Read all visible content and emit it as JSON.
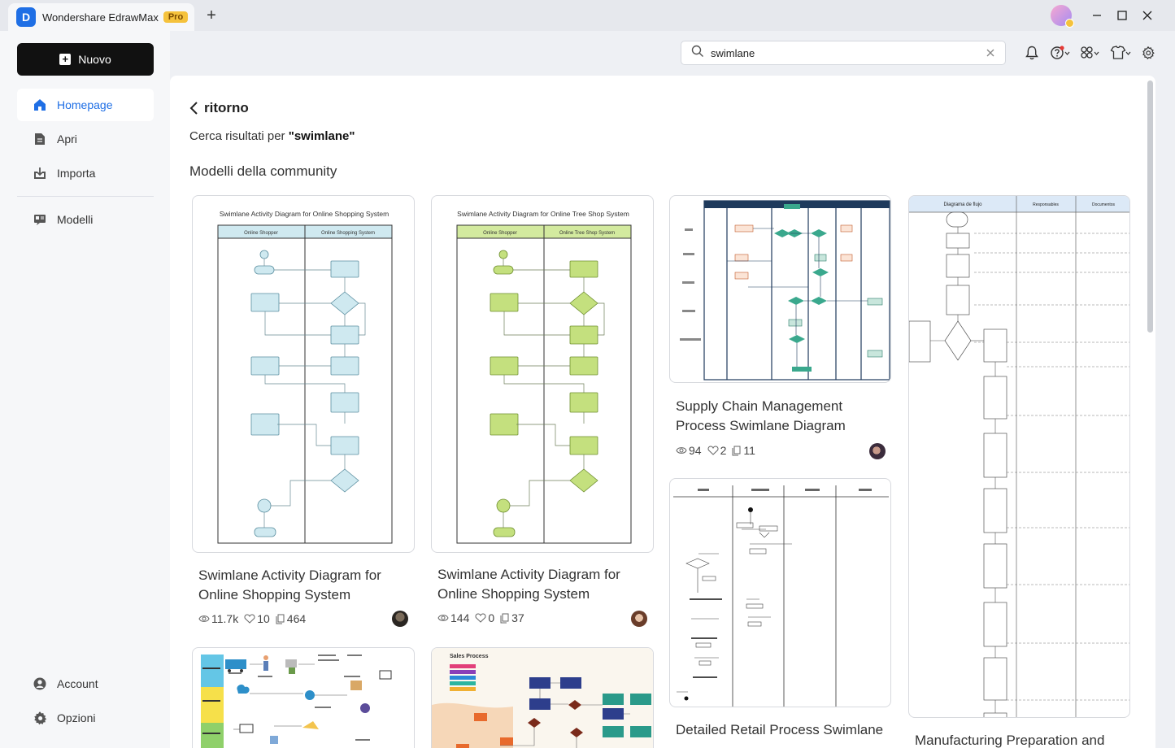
{
  "app": {
    "name": "Wondershare EdrawMax",
    "badge": "Pro",
    "logo_letter": "D"
  },
  "sidebar": {
    "new_label": "Nuovo",
    "items": [
      {
        "label": "Homepage",
        "icon": "home-icon",
        "active": true
      },
      {
        "label": "Apri",
        "icon": "file-icon"
      },
      {
        "label": "Importa",
        "icon": "import-icon"
      },
      {
        "label": "Modelli",
        "icon": "templates-icon"
      }
    ],
    "bottom": [
      {
        "label": "Account",
        "icon": "account-icon"
      },
      {
        "label": "Opzioni",
        "icon": "gear-icon"
      }
    ]
  },
  "search": {
    "value": "swimlane",
    "placeholder": ""
  },
  "main": {
    "back_label": "ritorno",
    "results_prefix": "Cerca risultati per ",
    "results_query": "\"swimlane\"",
    "section_title": "Modelli della community"
  },
  "cards": [
    {
      "title": "Swimlane Activity Diagram for Online Shopping System",
      "views": "11.7k",
      "likes": "10",
      "copies": "464",
      "thumb_title": "Swimlane Activity Diagram for Online Shopping System",
      "lanes": [
        "Online Shopper",
        "Online Shopping System"
      ],
      "accent": "#cfe9f0"
    },
    {
      "title": "Swimlane Activity Diagram for Online Shopping System",
      "views": "144",
      "likes": "0",
      "copies": "37",
      "thumb_title": "Swimlane Activity Diagram for Online Tree Shop System",
      "lanes": [
        "Online Shopper",
        "Online Tree Shop System"
      ],
      "accent": "#d3ea9f"
    },
    {
      "title": "Supply Chain Management Process Swimlane Diagram",
      "views": "94",
      "likes": "2",
      "copies": "11"
    },
    {
      "title": "Manufacturing Preparation and",
      "thumb_title": "Diagrama de flujo",
      "lanes": [
        "Responsables",
        "Documentos"
      ]
    },
    {
      "title": "Detailed Retail Process Swimlane"
    },
    {
      "thumb_title": "Sales Process"
    }
  ]
}
